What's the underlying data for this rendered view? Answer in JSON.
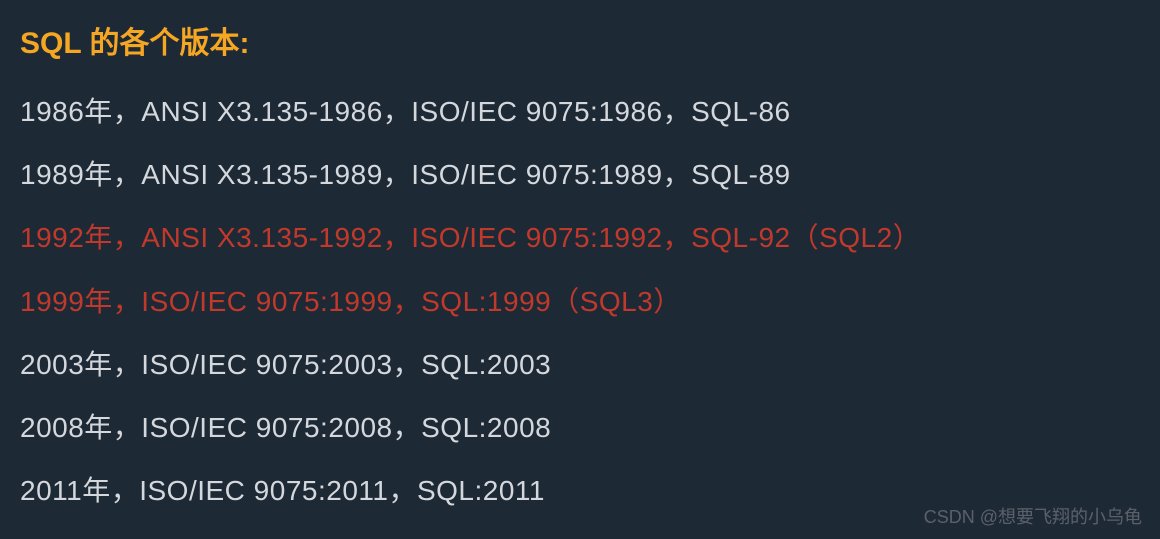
{
  "title": "SQL 的各个版本:",
  "lines": [
    {
      "text": "1986年，ANSI X3.135-1986，ISO/IEC 9075:1986，SQL-86",
      "highlight": false
    },
    {
      "text": "1989年，ANSI X3.135-1989，ISO/IEC 9075:1989，SQL-89",
      "highlight": false
    },
    {
      "text": "1992年，ANSI X3.135-1992，ISO/IEC 9075:1992，SQL-92（SQL2）",
      "highlight": true
    },
    {
      "text": "1999年，ISO/IEC 9075:1999，SQL:1999（SQL3）",
      "highlight": true
    },
    {
      "text": "2003年，ISO/IEC 9075:2003，SQL:2003",
      "highlight": false
    },
    {
      "text": "2008年，ISO/IEC 9075:2008，SQL:2008",
      "highlight": false
    },
    {
      "text": "2011年，ISO/IEC 9075:2011，SQL:2011",
      "highlight": false
    }
  ],
  "watermark": "CSDN @想要飞翔的小乌龟"
}
